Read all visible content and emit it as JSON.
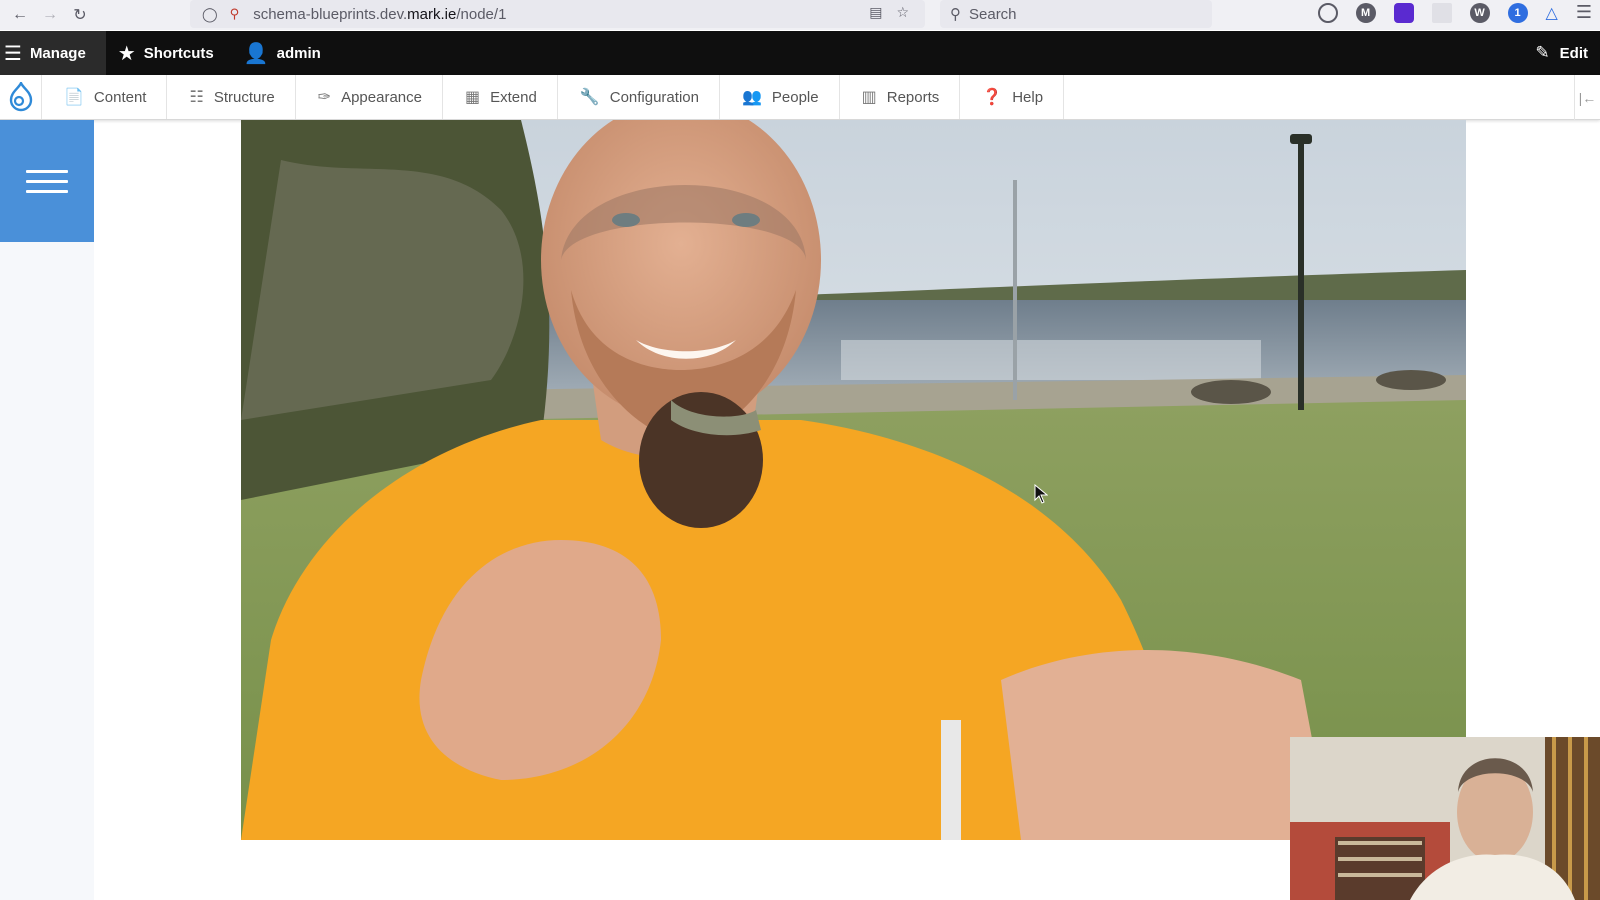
{
  "browser": {
    "url_prefix": "schema-blueprints.dev.",
    "url_domain": "mark.ie",
    "url_path": "/node/1",
    "search_placeholder": "Search"
  },
  "toolbar": {
    "manage_label": "Manage",
    "shortcuts_label": "Shortcuts",
    "user_label": "admin",
    "edit_label": "Edit"
  },
  "tray": {
    "items": [
      {
        "label": "Content",
        "icon": "file-icon"
      },
      {
        "label": "Structure",
        "icon": "sitemap-icon"
      },
      {
        "label": "Appearance",
        "icon": "brush-icon"
      },
      {
        "label": "Extend",
        "icon": "puzzle-icon"
      },
      {
        "label": "Configuration",
        "icon": "wrench-icon"
      },
      {
        "label": "People",
        "icon": "people-icon"
      },
      {
        "label": "Reports",
        "icon": "bar-chart-icon"
      },
      {
        "label": "Help",
        "icon": "help-icon"
      }
    ]
  },
  "colors": {
    "toolbar_bg": "#0f0f0f",
    "menu_button": "#4a90d9",
    "shirt": "#f5a623"
  }
}
